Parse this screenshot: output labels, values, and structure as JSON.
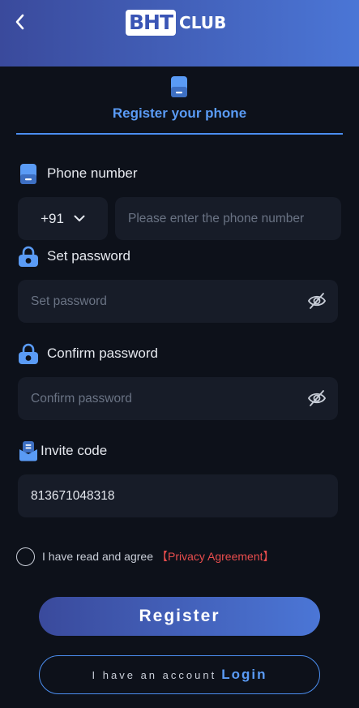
{
  "header": {
    "logo_main": "BHT",
    "logo_sub": "CLUB"
  },
  "tab": {
    "label": "Register your phone"
  },
  "phone": {
    "label": "Phone number",
    "country_code": "+91",
    "placeholder": "Please enter the phone number"
  },
  "password": {
    "label": "Set password",
    "placeholder": "Set password"
  },
  "confirm": {
    "label": "Confirm password",
    "placeholder": "Confirm password"
  },
  "invite": {
    "label": "Invite code",
    "value": "813671048318"
  },
  "agreement": {
    "text": "I have read and agree",
    "link": "【Privacy Agreement】"
  },
  "buttons": {
    "register": "Register",
    "have_account": "I have an account",
    "login": "Login"
  },
  "colors": {
    "accent": "#4b8ef0",
    "header_start": "#3a4a9c",
    "header_end": "#4b76d6",
    "link_red": "#e84d4d",
    "background": "#0d111a",
    "input_bg": "#171c28"
  }
}
